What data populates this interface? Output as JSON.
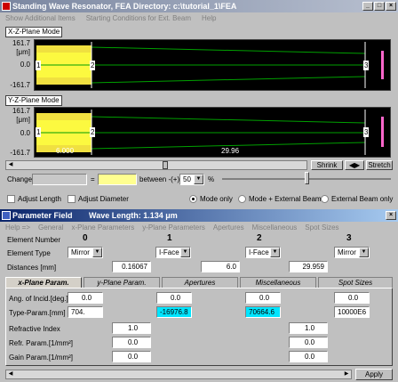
{
  "main_window": {
    "title": "Standing Wave Resonator, FEA Directory: c:\\tutorial_1\\FEA",
    "menu": [
      "Show Additional Items",
      "Starting Conditions for Ext. Beam",
      "Help"
    ]
  },
  "xz": {
    "label": "X-Z-Plane Mode",
    "y_top": "161.7",
    "y_unit": "[μm]",
    "y_zero": "0.0",
    "y_bottom": "-161.7",
    "elements": [
      "1",
      "2",
      "3"
    ]
  },
  "yz": {
    "label": "Y-Z-Plane Mode",
    "y_top": "161.7",
    "y_unit": "[μm]",
    "y_zero": "0.0",
    "y_bottom": "-161.7",
    "elements": [
      "1",
      "2",
      "3"
    ],
    "dist1": "6.000",
    "dist2": "29.96"
  },
  "scroll": {
    "shrink": "Shrink",
    "stretch": "Stretch"
  },
  "change": {
    "label": "Change",
    "eq": "=",
    "between": "between -(+)",
    "percent_value": "50",
    "percent_sign": "%"
  },
  "options": {
    "adjust_length": "Adjust Length",
    "adjust_diameter": "Adjust Diameter",
    "mode_only": "Mode only",
    "mode_ext": "Mode + External Beam",
    "ext_only": "External Beam only"
  },
  "param_window": {
    "title": "Parameter Field",
    "wavelength": "Wave Length: 1.134 μm",
    "menu": [
      "Help =>",
      "General",
      "x-Plane Parameters",
      "y-Plane Parameters",
      "Apertures",
      "Miscellaneous",
      "Spot Sizes"
    ]
  },
  "elements": {
    "label_number": "Element Number",
    "label_type": "Element Type",
    "label_dist": "Distances [mm]",
    "numbers": [
      "0",
      "1",
      "2",
      "3"
    ],
    "types": [
      "Mirror",
      "I-Face",
      "I-Face",
      "Mirror"
    ],
    "distances": [
      "0.16067",
      "6.0",
      "29.959"
    ]
  },
  "tabs": [
    "x-Plane Param.",
    "y-Plane Param.",
    "Apertures",
    "Miscellaneous",
    "Spot Sizes"
  ],
  "params": {
    "angle_label": "Ang. of Incid.[deg.]",
    "angle": [
      "0.0",
      "0.0",
      "0.0",
      "0.0"
    ],
    "type_label": "Type-Param.[mm]",
    "type": [
      "704.",
      "-16976.8",
      "70664.6",
      "10000E6"
    ],
    "refr_label": "Refractive Index",
    "refr": [
      "1.0",
      "1.0"
    ],
    "refr_param_label": "Refr. Param.[1/mm²]",
    "refr_param": [
      "0.0",
      "0.0"
    ],
    "gain_label": "Gain Param.[1/mm²]",
    "gain": [
      "0.0",
      "0.0"
    ]
  },
  "apply": "Apply"
}
